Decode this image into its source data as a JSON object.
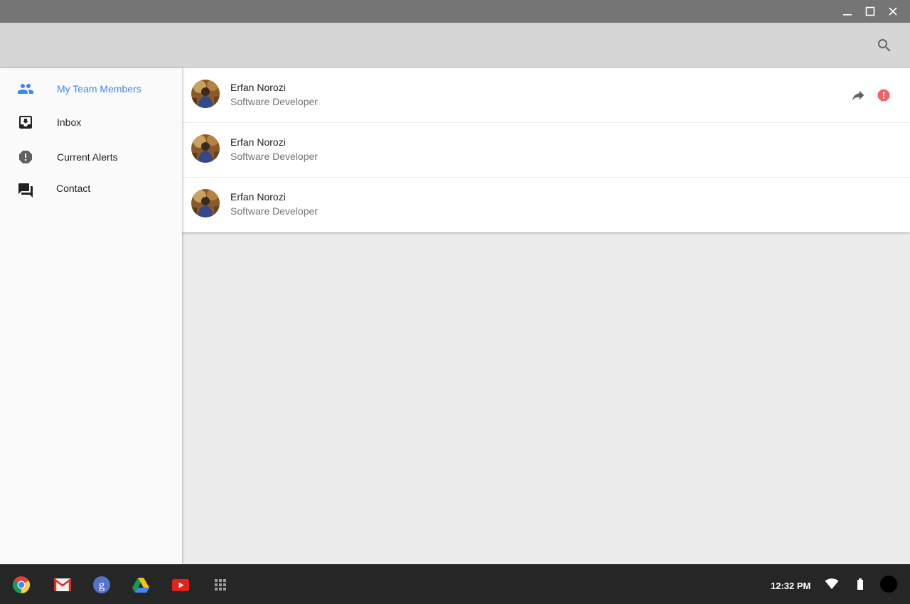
{
  "window": {
    "minimize_icon": "minimize-icon",
    "maximize_icon": "maximize-icon",
    "close_icon": "close-icon"
  },
  "toolbar": {
    "search_icon": "search-icon"
  },
  "sidebar": {
    "items": [
      {
        "label": "My Team Members",
        "icon": "people-icon",
        "active": true
      },
      {
        "label": "Inbox",
        "icon": "inbox-icon",
        "active": false
      },
      {
        "label": "Current Alerts",
        "icon": "alert-icon",
        "active": false
      },
      {
        "label": "Contact",
        "icon": "forum-icon",
        "active": false
      }
    ]
  },
  "members": [
    {
      "name": "Erfan Norozi",
      "role": "Software Developer",
      "actions": [
        "share-icon",
        "alert-icon"
      ]
    },
    {
      "name": "Erfan Norozi",
      "role": "Software Developer",
      "actions": []
    },
    {
      "name": "Erfan Norozi",
      "role": "Software Developer",
      "actions": []
    }
  ],
  "shelf": {
    "apps": [
      "chrome-icon",
      "gmail-icon",
      "google-search-icon",
      "drive-icon",
      "youtube-icon",
      "app-launcher-icon"
    ],
    "clock": "12:32 PM",
    "tray": [
      "wifi-icon",
      "battery-icon",
      "account-avatar"
    ]
  },
  "colors": {
    "accent": "#4285f4",
    "alert": "#f0626b",
    "titlebar": "#757575",
    "toolbar": "#d6d6d6",
    "shelf": "#262626"
  }
}
